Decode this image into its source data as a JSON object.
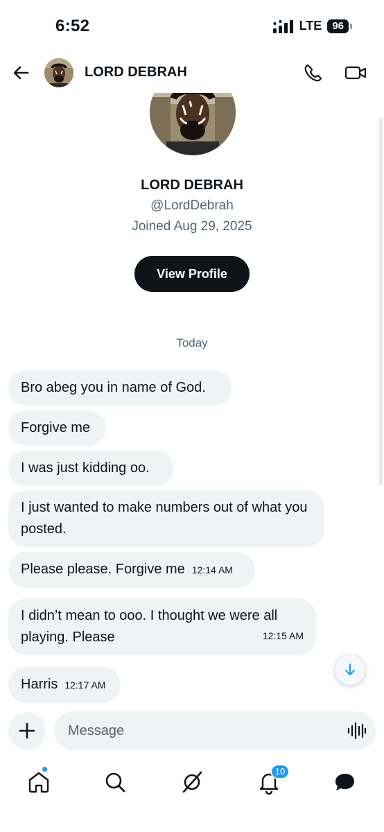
{
  "status_bar": {
    "time": "6:52",
    "network": "LTE",
    "battery": "96"
  },
  "header": {
    "name": "LORD DEBRAH",
    "icons": [
      "back-arrow-icon",
      "phone-icon",
      "video-camera-icon"
    ]
  },
  "profile": {
    "name": "LORD DEBRAH",
    "handle": "@LordDebrah",
    "joined": "Joined Aug 29, 2025",
    "view_profile_label": "View Profile"
  },
  "conversation": {
    "day_label": "Today",
    "messages": [
      {
        "text": "Bro abeg you in name of God.",
        "time": ""
      },
      {
        "text": "Forgive me",
        "time": ""
      },
      {
        "text": "I was just kidding oo.",
        "time": ""
      },
      {
        "text": "I just wanted to make numbers out of what you posted.",
        "time": ""
      },
      {
        "text": "Please please. Forgive me",
        "time": "12:14 AM"
      },
      {
        "text": "I didn’t mean to ooo. I thought we were all playing. Please",
        "time": "12:15 AM"
      },
      {
        "text": "Harris",
        "time": "12:17 AM"
      }
    ]
  },
  "composer": {
    "placeholder": "Message"
  },
  "bottom_nav": {
    "items": [
      "home-icon",
      "search-icon",
      "grok-icon",
      "bell-icon",
      "messages-icon"
    ],
    "notification_count": "10"
  },
  "colors": {
    "accent": "#1d9bf0",
    "bubble": "#eff3f4",
    "dark": "#0f1419",
    "muted": "#536471"
  }
}
